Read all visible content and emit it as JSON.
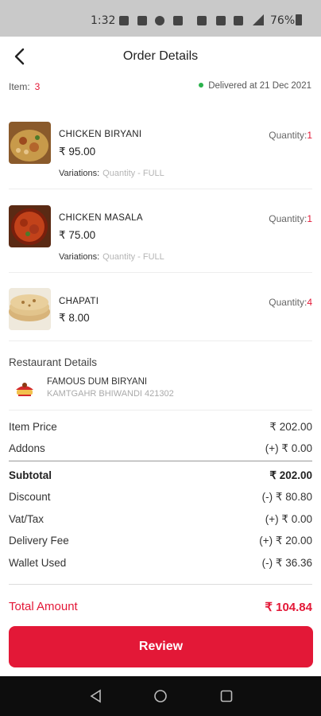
{
  "status_bar": {
    "time": "1:32",
    "battery": "76%"
  },
  "header": {
    "title": "Order Details"
  },
  "summary": {
    "item_label": "Item:",
    "item_count": "3",
    "delivered_text": "Delivered at 21 Dec 2021"
  },
  "items": [
    {
      "name": "CHICKEN BIRYANI",
      "qty_label": "Quantity:",
      "qty": "1",
      "price": "₹ 95.00",
      "variations_label": "Variations:",
      "variations": "Quantity - FULL",
      "image": "biryani-plate"
    },
    {
      "name": "CHICKEN MASALA",
      "qty_label": "Quantity:",
      "qty": "1",
      "price": "₹ 75.00",
      "variations_label": "Variations:",
      "variations": "Quantity - FULL",
      "image": "masala-bowl"
    },
    {
      "name": "CHAPATI",
      "qty_label": "Quantity:",
      "qty": "4",
      "price": "₹ 8.00",
      "image": "chapati-stack"
    }
  ],
  "restaurant": {
    "section_title": "Restaurant Details",
    "name": "FAMOUS DUM BIRYANI",
    "address": "KAMTGAHR BHIWANDI 421302"
  },
  "pricing": {
    "item_price_label": "Item Price",
    "item_price": "₹ 202.00",
    "addons_label": "Addons",
    "addons": "(+) ₹ 0.00",
    "subtotal_label": "Subtotal",
    "subtotal": "₹ 202.00",
    "discount_label": "Discount",
    "discount": "(-) ₹ 80.80",
    "vat_label": "Vat/Tax",
    "vat": "(+) ₹ 0.00",
    "delivery_label": "Delivery Fee",
    "delivery": "(+) ₹ 20.00",
    "wallet_label": "Wallet Used",
    "wallet": "(-) ₹ 36.36",
    "total_label": "Total Amount",
    "total": "₹ 104.84"
  },
  "actions": {
    "review_label": "Review"
  },
  "colors": {
    "accent": "#e31837",
    "delivered_dot": "#2bb24c",
    "status_bar": "#c9c9c9",
    "nav_bar": "#0d0d0d"
  },
  "icons": [
    "back-arrow-icon",
    "nav-back-icon",
    "nav-home-icon",
    "nav-recents-icon",
    "battery-icon",
    "signal-icon"
  ]
}
